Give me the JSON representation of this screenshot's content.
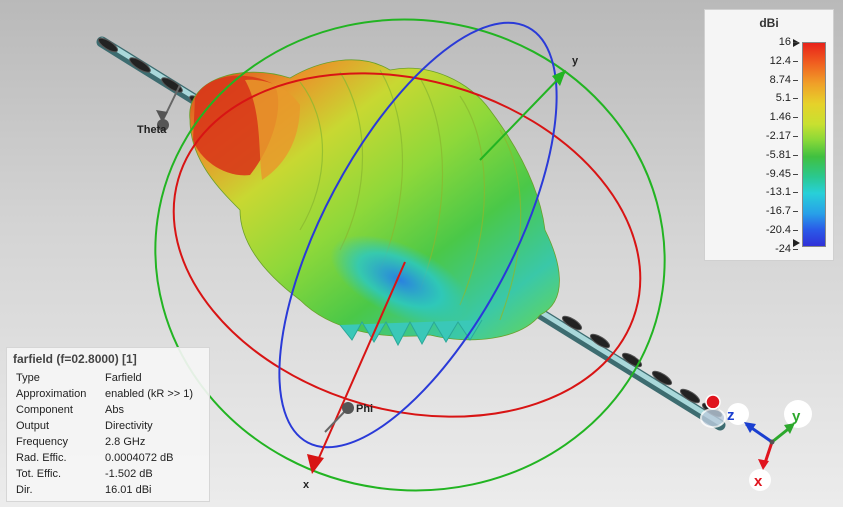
{
  "legend": {
    "unit": "dBi",
    "ticks": [
      "16",
      "12.4",
      "8.74",
      "5.1",
      "1.46",
      "-2.17",
      "-5.81",
      "-9.45",
      "-13.1",
      "-16.7",
      "-20.4",
      "-24"
    ]
  },
  "info": {
    "title": "farfield (f=02.8000) [1]",
    "rows": [
      {
        "key": "Type",
        "value": "Farfield"
      },
      {
        "key": "Approximation",
        "value": "enabled (kR >> 1)"
      },
      {
        "key": "Component",
        "value": "Abs"
      },
      {
        "key": "Output",
        "value": "Directivity"
      },
      {
        "key": "Frequency",
        "value": "2.8 GHz"
      },
      {
        "key": "Rad. Effic.",
        "value": "0.0004072 dB"
      },
      {
        "key": "Tot. Effic.",
        "value": "-1.502 dB"
      },
      {
        "key": "Dir.",
        "value": "16.01 dBi"
      }
    ]
  },
  "plot": {
    "theta_label": "Theta",
    "phi_label": "Phi",
    "x_label": "x",
    "y_label": "y",
    "circle_colors": {
      "red": "#d81414",
      "green": "#22b422",
      "blue": "#2a3ad8"
    }
  },
  "triad": {
    "x_label": "x",
    "y_label": "y",
    "z_label": "z",
    "x_color": "#e0141e",
    "y_color": "#2ca82c",
    "z_color": "#1a3fd0"
  }
}
